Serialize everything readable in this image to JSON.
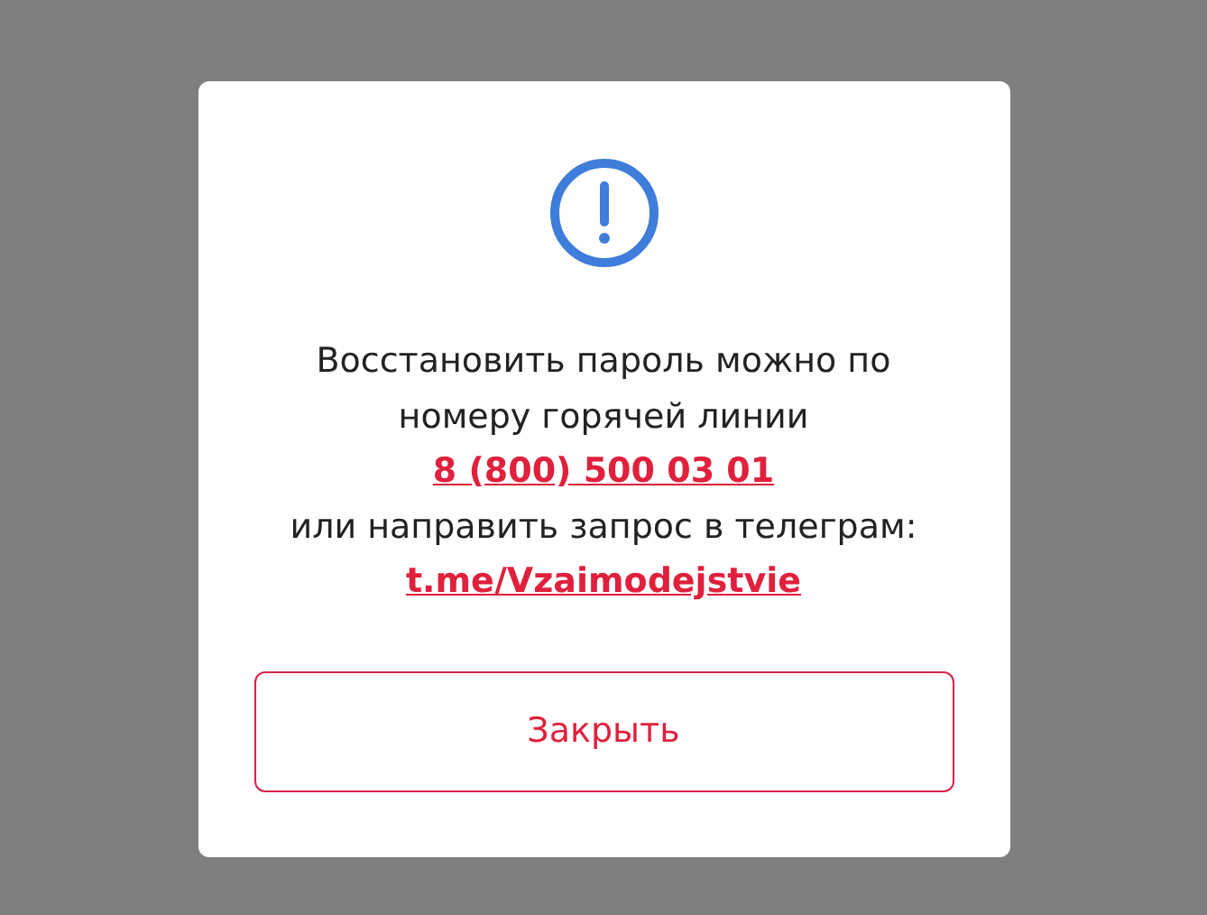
{
  "dialog": {
    "message": "Восстановить пароль можно по номеру горячей линии",
    "phone": "8 (800) 500 03 01",
    "telegram_prompt": "или направить запрос в телеграм:",
    "telegram_link": "t.me/Vzaimodejstvie",
    "button": "Закрыть"
  }
}
